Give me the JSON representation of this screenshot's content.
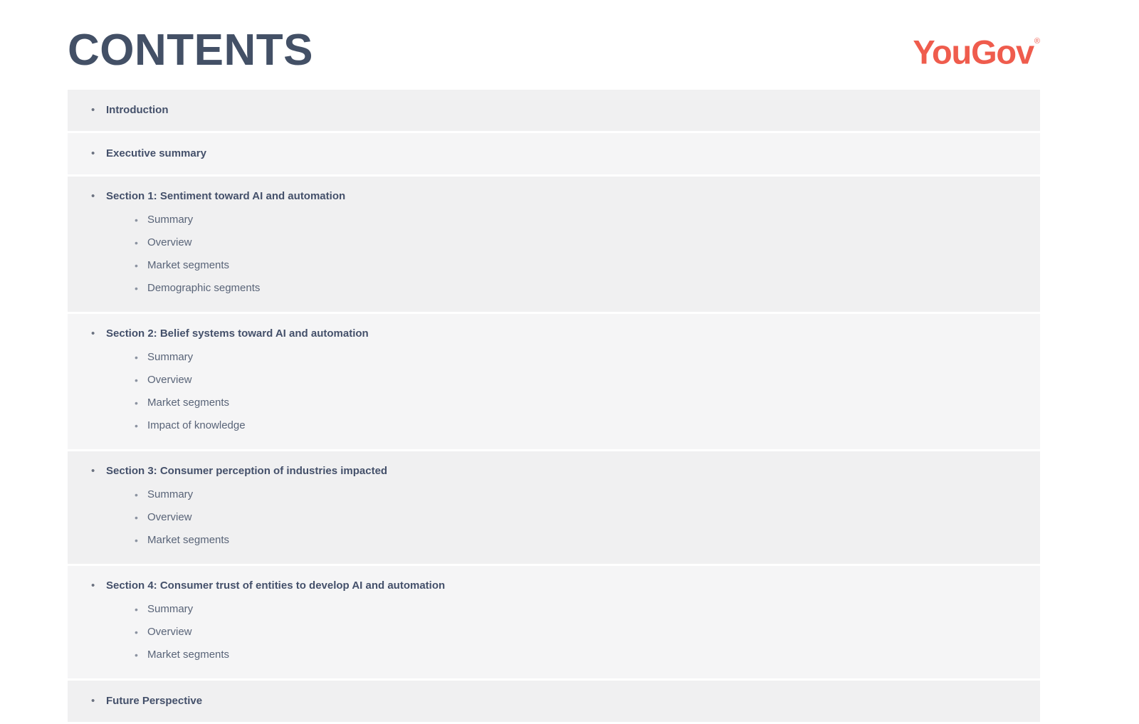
{
  "header": {
    "title": "CONTENTS",
    "brand": {
      "name": "YouGov",
      "trademark": "®",
      "color": "#ef5c4d"
    }
  },
  "theme": {
    "title_color": "#435066",
    "entry_color": "#44506a",
    "subentry_color": "#596478",
    "row_bg_dark": "#f0f0f1",
    "row_bg_light": "#f5f5f6",
    "page_bg": "#ffffff",
    "bullet_glyph": "•"
  },
  "contents": {
    "rows": [
      {
        "label": "Introduction",
        "shade": "dark",
        "children": []
      },
      {
        "label": "Executive summary",
        "shade": "light",
        "children": []
      },
      {
        "label": "Section 1: Sentiment toward AI and automation",
        "shade": "dark",
        "children": [
          {
            "label": "Summary"
          },
          {
            "label": "Overview"
          },
          {
            "label": "Market segments"
          },
          {
            "label": "Demographic segments"
          }
        ]
      },
      {
        "label": "Section 2: Belief systems toward AI and automation",
        "shade": "light",
        "children": [
          {
            "label": "Summary"
          },
          {
            "label": "Overview"
          },
          {
            "label": "Market segments"
          },
          {
            "label": "Impact of knowledge"
          }
        ]
      },
      {
        "label": "Section 3: Consumer perception of industries impacted",
        "shade": "dark",
        "children": [
          {
            "label": "Summary"
          },
          {
            "label": "Overview"
          },
          {
            "label": "Market segments"
          }
        ]
      },
      {
        "label": "Section 4: Consumer trust of entities to develop AI and automation",
        "shade": "light",
        "children": [
          {
            "label": "Summary"
          },
          {
            "label": "Overview"
          },
          {
            "label": "Market segments"
          }
        ]
      },
      {
        "label": "Future Perspective",
        "shade": "dark",
        "children": []
      }
    ]
  }
}
